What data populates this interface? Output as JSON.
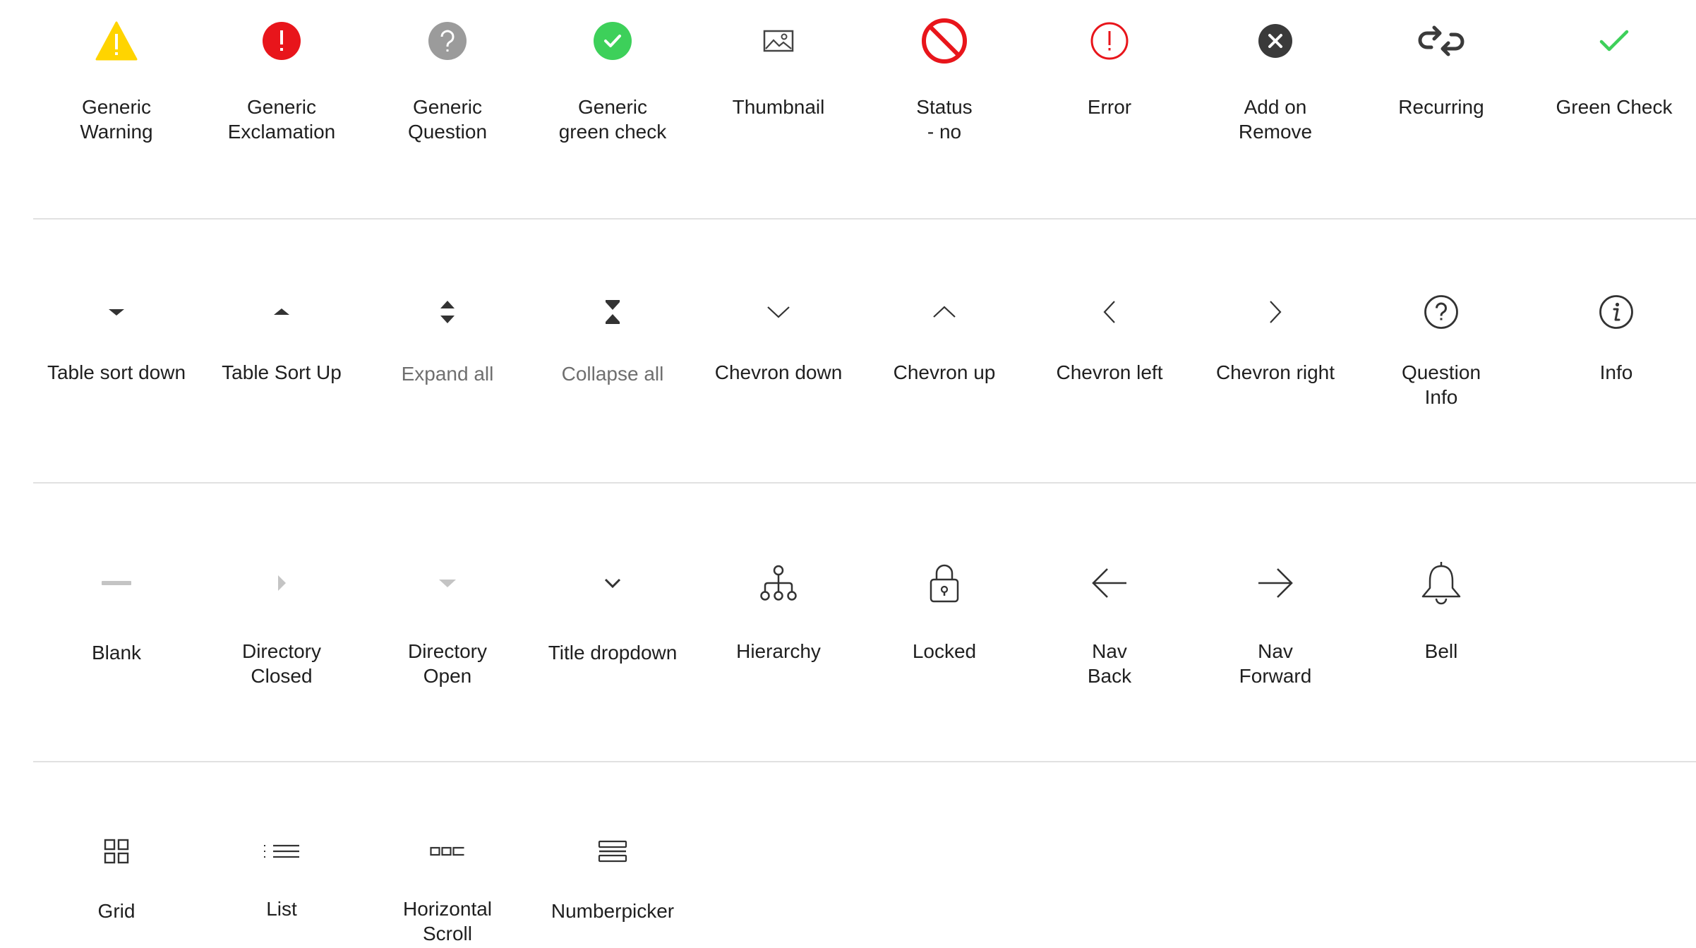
{
  "rows": [
    [
      {
        "label": "Generic\nWarning",
        "icon": "warning-icon"
      },
      {
        "label": "Generic\nExclamation",
        "icon": "exclamation-icon"
      },
      {
        "label": "Generic\nQuestion",
        "icon": "question-icon"
      },
      {
        "label": "Generic\ngreen check",
        "icon": "green-check-circle-icon"
      },
      {
        "label": "Thumbnail",
        "icon": "thumbnail-icon"
      },
      {
        "label": "Status\n- no",
        "icon": "no-entry-icon"
      },
      {
        "label": "Error",
        "icon": "error-icon"
      },
      {
        "label": "Add on\nRemove",
        "icon": "remove-icon"
      },
      {
        "label": "Recurring",
        "icon": "recurring-icon"
      },
      {
        "label": "Green Check",
        "icon": "check-icon"
      }
    ],
    [
      {
        "label": "Table sort down",
        "icon": "sort-down-icon"
      },
      {
        "label": "Table Sort Up",
        "icon": "sort-up-icon"
      },
      {
        "label": "Expand all",
        "icon": "expand-all-icon"
      },
      {
        "label": "Collapse all",
        "icon": "collapse-all-icon"
      },
      {
        "label": "Chevron down",
        "icon": "chevron-down-icon"
      },
      {
        "label": "Chevron up",
        "icon": "chevron-up-icon"
      },
      {
        "label": "Chevron left",
        "icon": "chevron-left-icon"
      },
      {
        "label": "Chevron right",
        "icon": "chevron-right-icon"
      },
      {
        "label": "Question\nInfo",
        "icon": "question-info-icon"
      },
      {
        "label": "Info",
        "icon": "info-icon"
      }
    ],
    [
      {
        "label": "Blank",
        "icon": "blank-icon"
      },
      {
        "label": "Directory\nClosed",
        "icon": "directory-closed-icon"
      },
      {
        "label": "Directory\nOpen",
        "icon": "directory-open-icon"
      },
      {
        "label": "Title dropdown",
        "icon": "title-dropdown-icon"
      },
      {
        "label": "Hierarchy",
        "icon": "hierarchy-icon"
      },
      {
        "label": "Locked",
        "icon": "lock-icon"
      },
      {
        "label": "Nav\nBack",
        "icon": "arrow-left-icon"
      },
      {
        "label": "Nav\nForward",
        "icon": "arrow-right-icon"
      },
      {
        "label": "Bell",
        "icon": "bell-icon"
      }
    ],
    [
      {
        "label": "Grid",
        "icon": "grid-icon"
      },
      {
        "label": "List",
        "icon": "list-icon"
      },
      {
        "label": "Horizontal\nScroll",
        "icon": "horizontal-scroll-icon"
      },
      {
        "label": "Numberpicker",
        "icon": "numberpicker-icon"
      }
    ]
  ],
  "colors": {
    "warning": "#FFD400",
    "exclamation": "#E8151B",
    "question": "#9B9B9B",
    "green": "#3DD05A",
    "dark": "#3A3A3A",
    "muted": "#BDBDBD"
  }
}
